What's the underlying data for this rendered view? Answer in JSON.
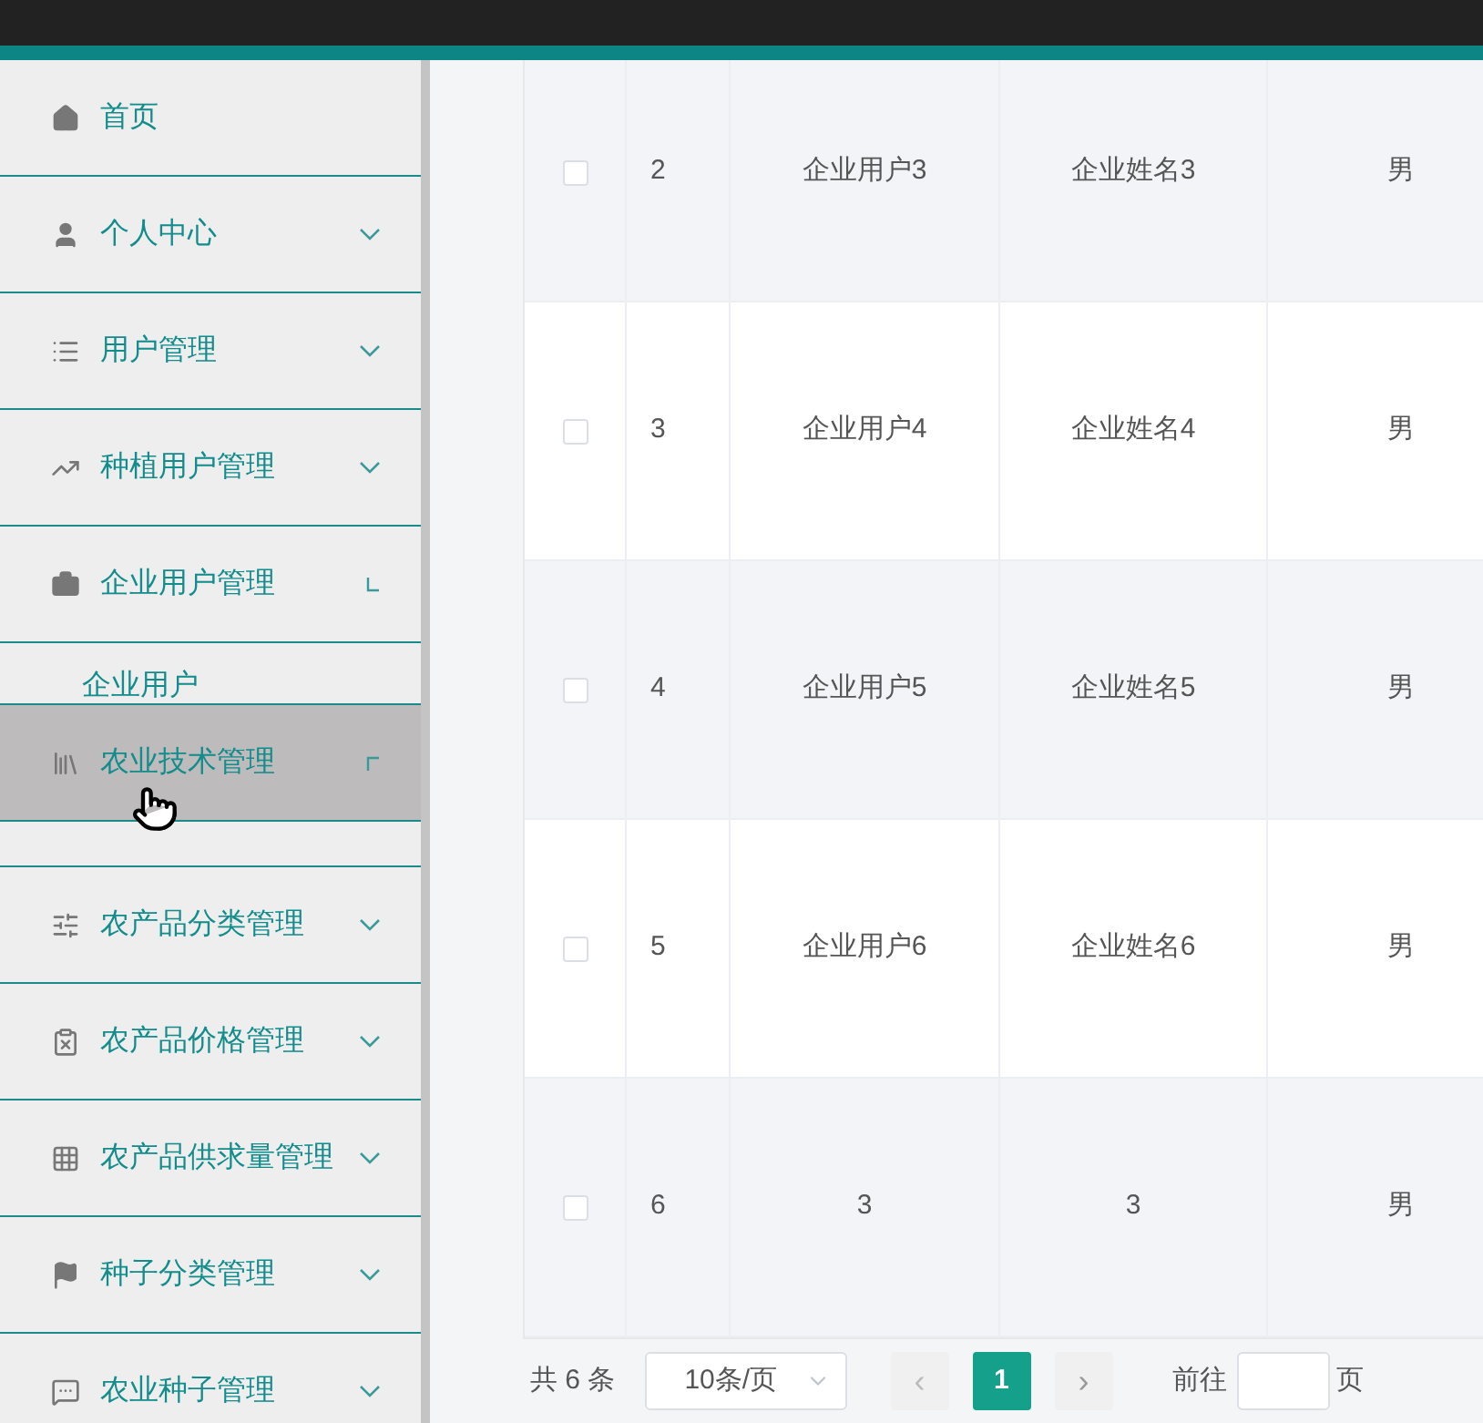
{
  "sidebar": {
    "items": [
      {
        "label": "首页",
        "hovered": false
      },
      {
        "label": "个人中心",
        "expanded": false,
        "hovered": false
      },
      {
        "label": "用户管理",
        "expanded": false,
        "hovered": false
      },
      {
        "label": "种植用户管理",
        "expanded": false,
        "hovered": false
      },
      {
        "label": "企业用户管理",
        "expanded": true,
        "hovered": false,
        "children": [
          {
            "label": "企业用户"
          }
        ]
      },
      {
        "label": "农业技术管理",
        "expanded": true,
        "hovered": true
      },
      {
        "label": "农产品分类管理",
        "expanded": false,
        "hovered": false
      },
      {
        "label": "农产品价格管理",
        "expanded": false,
        "hovered": false
      },
      {
        "label": "农产品供求量管理",
        "expanded": false,
        "hovered": false
      },
      {
        "label": "种子分类管理",
        "expanded": false,
        "hovered": false
      },
      {
        "label": "农业种子管理",
        "expanded": false,
        "hovered": false
      }
    ]
  },
  "table": {
    "rows": [
      {
        "checked": false,
        "index": "2",
        "username": "企业用户3",
        "name": "企业姓名3",
        "gender": "男"
      },
      {
        "checked": false,
        "index": "3",
        "username": "企业用户4",
        "name": "企业姓名4",
        "gender": "男"
      },
      {
        "checked": false,
        "index": "4",
        "username": "企业用户5",
        "name": "企业姓名5",
        "gender": "男"
      },
      {
        "checked": false,
        "index": "5",
        "username": "企业用户6",
        "name": "企业姓名6",
        "gender": "男"
      },
      {
        "checked": false,
        "index": "6",
        "username": "3",
        "name": "3",
        "gender": "男"
      }
    ]
  },
  "pagination": {
    "total": "共 6 条",
    "page_size": "10条/页",
    "prev": "‹",
    "pages": [
      {
        "label": "1",
        "selected": true
      }
    ],
    "next": "›",
    "goto_label": "前往",
    "goto_suffix": "页"
  }
}
